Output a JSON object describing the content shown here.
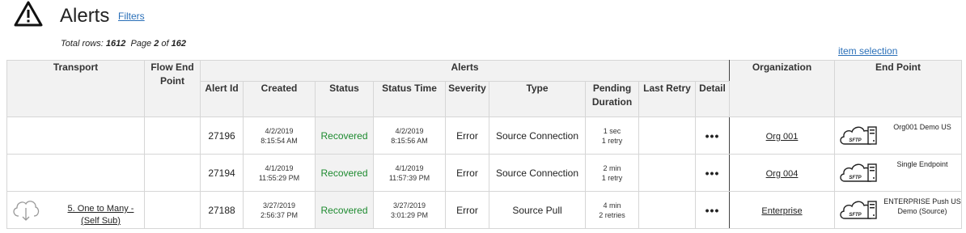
{
  "header": {
    "title": "Alerts",
    "filters_label": "Filters",
    "total_rows_label": "Total rows:",
    "total_rows": "1612",
    "page_label": "Page",
    "page": "2",
    "of_label": "of",
    "page_count": "162",
    "item_selection_label": "item selection"
  },
  "columns": {
    "transport": "Transport",
    "flow_end_point": "Flow End Point",
    "alerts_group": "Alerts",
    "alert_id": "Alert Id",
    "created": "Created",
    "status": "Status",
    "status_time": "Status Time",
    "severity": "Severity",
    "type": "Type",
    "pending_duration": "Pending Duration",
    "last_retry": "Last Retry",
    "detail": "Detail",
    "organization": "Organization",
    "end_point": "End Point"
  },
  "colors": {
    "alerts_banner": "#f05252",
    "recovered": "#1d8a2f",
    "link": "#2a6fb8"
  },
  "rows": [
    {
      "transport_icon": "",
      "transport": "",
      "flow_end_point": "",
      "alert_id": "27196",
      "created_date": "4/2/2019",
      "created_time": "8:15:54 AM",
      "status": "Recovered",
      "status_date": "4/2/2019",
      "status_time": "8:15:56 AM",
      "severity": "Error",
      "type": "Source Connection",
      "pending_duration": "1 sec",
      "pending_retries": "1 retry",
      "last_retry": "",
      "detail": "•••",
      "organization": "Org 001",
      "end_point_icon": "sftp-cloud-icon",
      "end_point_icon_text": "SFTP",
      "end_point": "Org001 Demo US"
    },
    {
      "transport_icon": "",
      "transport": "",
      "flow_end_point": "",
      "alert_id": "27194",
      "created_date": "4/1/2019",
      "created_time": "11:55:29 PM",
      "status": "Recovered",
      "status_date": "4/1/2019",
      "status_time": "11:57:39 PM",
      "severity": "Error",
      "type": "Source Connection",
      "pending_duration": "2 min",
      "pending_retries": "1 retry",
      "last_retry": "",
      "detail": "•••",
      "organization": "Org 004",
      "end_point_icon": "sftp-cloud-icon",
      "end_point_icon_text": "SFTP",
      "end_point": "Single Endpoint"
    },
    {
      "transport_icon": "cloud-download-icon",
      "transport": "5. One to Many - (Self Sub)",
      "flow_end_point": "",
      "alert_id": "27188",
      "created_date": "3/27/2019",
      "created_time": "2:56:37 PM",
      "status": "Recovered",
      "status_date": "3/27/2019",
      "status_time": "3:01:29 PM",
      "severity": "Error",
      "type": "Source Pull",
      "pending_duration": "4 min",
      "pending_retries": "2 retries",
      "last_retry": "",
      "detail": "•••",
      "organization": "Enterprise",
      "end_point_icon": "sftp-cloud-icon",
      "end_point_icon_text": "SFTP",
      "end_point": "ENTERPRISE Push US Demo (Source)"
    }
  ]
}
